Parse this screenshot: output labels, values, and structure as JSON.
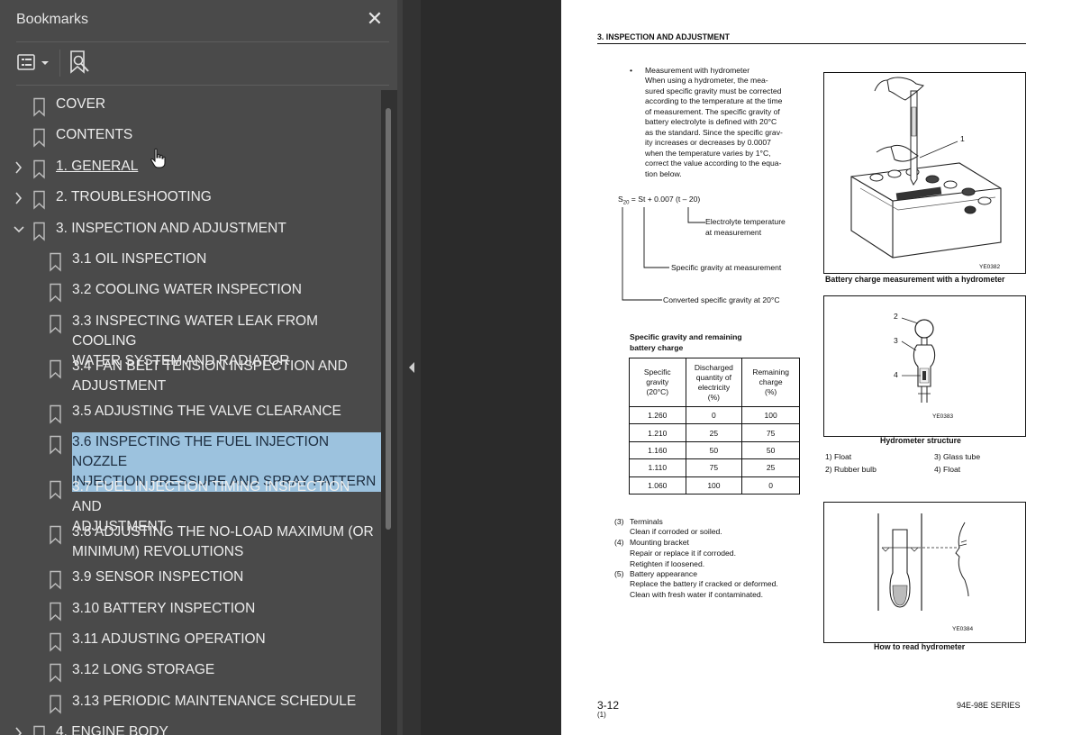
{
  "panel": {
    "title": "Bookmarks",
    "close_symbol": "✕",
    "toolbar": {
      "options_icon": "list-options-icon",
      "find_icon": "find-bookmark-icon"
    }
  },
  "bookmarks": [
    {
      "label": "COVER",
      "level": 0,
      "expander": "none"
    },
    {
      "label": "CONTENTS",
      "level": 0,
      "expander": "none"
    },
    {
      "label": "1. GENERAL",
      "level": 0,
      "expander": "collapsed",
      "underlined": true
    },
    {
      "label": "2. TROUBLESHOOTING",
      "level": 0,
      "expander": "collapsed"
    },
    {
      "label": "3. INSPECTION AND ADJUSTMENT",
      "level": 0,
      "expander": "expanded"
    },
    {
      "label": "3.1 OIL INSPECTION",
      "level": 1
    },
    {
      "label": "3.2 COOLING WATER INSPECTION",
      "level": 1
    },
    {
      "label": "3.3 INSPECTING WATER LEAK FROM COOLING\nWATER SYSTEM AND RADIATOR",
      "level": 1
    },
    {
      "label": "3.4 FAN BELT TENSION INSPECTION AND\nADJUSTMENT",
      "level": 1
    },
    {
      "label": "3.5 ADJUSTING THE VALVE CLEARANCE",
      "level": 1
    },
    {
      "label": "3.6 INSPECTING THE FUEL INJECTION NOZZLE\nINJECTION PRESSURE AND SPRAY PATTERN",
      "level": 1,
      "selected": true
    },
    {
      "label": "3.7 FUEL INJECTION TIMING INSPECTION AND\nADJUSTMENT",
      "level": 1
    },
    {
      "label": "3.8 ADJUSTING THE NO-LOAD MAXIMUM (OR\nMINIMUM) REVOLUTIONS",
      "level": 1
    },
    {
      "label": "3.9 SENSOR INSPECTION",
      "level": 1
    },
    {
      "label": "3.10 BATTERY INSPECTION",
      "level": 1
    },
    {
      "label": "3.11 ADJUSTING OPERATION",
      "level": 1
    },
    {
      "label": "3.12 LONG STORAGE",
      "level": 1
    },
    {
      "label": "3.13 PERIODIC MAINTENANCE SCHEDULE",
      "level": 1
    },
    {
      "label": "4. ENGINE BODY",
      "level": 0,
      "expander": "collapsed"
    }
  ],
  "colors": {
    "panel_bg": "#4a4a4a",
    "selection": "#9cc2de",
    "viewer_bg": "#2b2b2b"
  },
  "doc": {
    "header": "3. INSPECTION AND ADJUSTMENT",
    "hydrometer_bullet": "Measurement with hydrometer",
    "hydrometer_text": "When using a hydrometer, the mea-\nsured specific gravity must be corrected\naccording to the temperature at the time\nof measurement. The specific gravity of\nbattery electrolyte is defined with 20°C\nas the standard. Since the specific grav-\nity increases or decreases by 0.0007\nwhen the temperature varies by 1°C,\ncorrect the value according to the equa-\ntion below.",
    "eq_s": "S",
    "eq_sub": "20",
    "eq_rest": " = St  +  0.007 (t – 20)",
    "eq_label_temp": "Electrolyte temperature\nat measurement",
    "eq_label_sg": "Specific gravity at measurement",
    "eq_label_conv": "Converted specific gravity at 20°C",
    "table_title": "Specific gravity and remaining\nbattery charge",
    "table_headers": [
      "Specific\ngravity\n(20°C)",
      "Discharged\nquantity of\nelectricity\n(%)",
      "Remaining\ncharge\n(%)"
    ],
    "table_rows": [
      [
        "1.260",
        "0",
        "100"
      ],
      [
        "1.210",
        "25",
        "75"
      ],
      [
        "1.160",
        "50",
        "50"
      ],
      [
        "1.110",
        "75",
        "25"
      ],
      [
        "1.060",
        "100",
        "0"
      ]
    ],
    "list_items": [
      {
        "num": "(3)",
        "title": "Terminals",
        "desc": "Clean if corroded or soiled."
      },
      {
        "num": "(4)",
        "title": "Mounting bracket",
        "desc": "Repair or replace it if corroded.\nRetighten if loosened."
      },
      {
        "num": "(5)",
        "title": "Battery appearance",
        "desc": "Replace the battery if cracked or deformed.\nClean with fresh water if contaminated."
      }
    ],
    "fig1": {
      "code": "YE0382",
      "caption": "Battery charge measurement with a hydrometer",
      "callout": "1"
    },
    "fig2": {
      "code": "YE0383",
      "caption": "Hydrometer structure",
      "callouts": [
        "2",
        "3",
        "4"
      ],
      "legend": [
        "1)   Float",
        "2)   Rubber bulb",
        "3)   Glass tube",
        "4)   Float"
      ]
    },
    "fig3": {
      "code": "YE0384",
      "caption": "How to read hydrometer"
    },
    "footer_page": "3-12",
    "footer_sub": "(1)",
    "footer_series": "94E-98E SERIES"
  }
}
